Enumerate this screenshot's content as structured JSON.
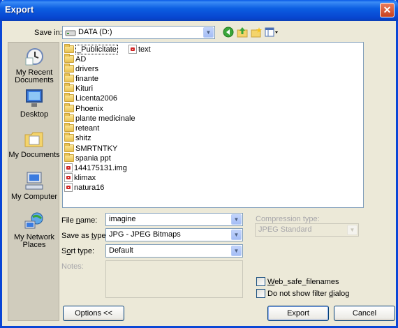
{
  "window": {
    "title": "Export",
    "close_symbol": "✕"
  },
  "save_in": {
    "label": "Save in:",
    "value": "DATA (D:)"
  },
  "places": [
    {
      "line1": "My Recent",
      "line2": "Documents",
      "icon": "recent-documents-icon"
    },
    {
      "line1": "Desktop",
      "line2": "",
      "icon": "desktop-icon"
    },
    {
      "line1": "My Documents",
      "line2": "",
      "icon": "my-documents-icon"
    },
    {
      "line1": "My Computer",
      "line2": "",
      "icon": "my-computer-icon"
    },
    {
      "line1": "My Network",
      "line2": "Places",
      "icon": "network-places-icon"
    }
  ],
  "files": {
    "column1": [
      {
        "name": "_Publicitate",
        "type": "folder"
      },
      {
        "name": "AD",
        "type": "folder"
      },
      {
        "name": "drivers",
        "type": "folder"
      },
      {
        "name": "finante",
        "type": "folder"
      },
      {
        "name": "Kituri",
        "type": "folder"
      },
      {
        "name": "Licenta2006",
        "type": "folder"
      },
      {
        "name": "Phoenix",
        "type": "folder"
      },
      {
        "name": "plante medicinale",
        "type": "folder"
      },
      {
        "name": "reteant",
        "type": "folder"
      },
      {
        "name": "shitz",
        "type": "folder"
      },
      {
        "name": "SMRTNTKY",
        "type": "folder"
      },
      {
        "name": "spania ppt",
        "type": "folder"
      },
      {
        "name": "144175131.img",
        "type": "file"
      },
      {
        "name": "klimax",
        "type": "file"
      },
      {
        "name": "natura16",
        "type": "file"
      }
    ],
    "column2": [
      {
        "name": "text",
        "type": "file"
      }
    ]
  },
  "form": {
    "file_name_label_pre": "File ",
    "file_name_label_u": "n",
    "file_name_label_post": "ame:",
    "file_name_value": "imagine",
    "save_as_label_pre": "Save as ",
    "save_as_label_u": "t",
    "save_as_label_post": "ype:",
    "save_as_value": "JPG - JPEG Bitmaps",
    "sort_label_pre": "S",
    "sort_label_u": "o",
    "sort_label_post": "rt type:",
    "sort_value": "Default",
    "notes_label": "Notes:",
    "compression_label": "Compression type:",
    "compression_value": "JPEG Standard"
  },
  "options": {
    "web_safe_pre": "",
    "web_safe_u": "W",
    "web_safe_post": "eb_safe_filenames",
    "no_filter_pre": "Do not show filter ",
    "no_filter_u": "d",
    "no_filter_post": "ialog"
  },
  "buttons": {
    "options": "Options <<",
    "export": "Export",
    "cancel": "Cancel"
  }
}
